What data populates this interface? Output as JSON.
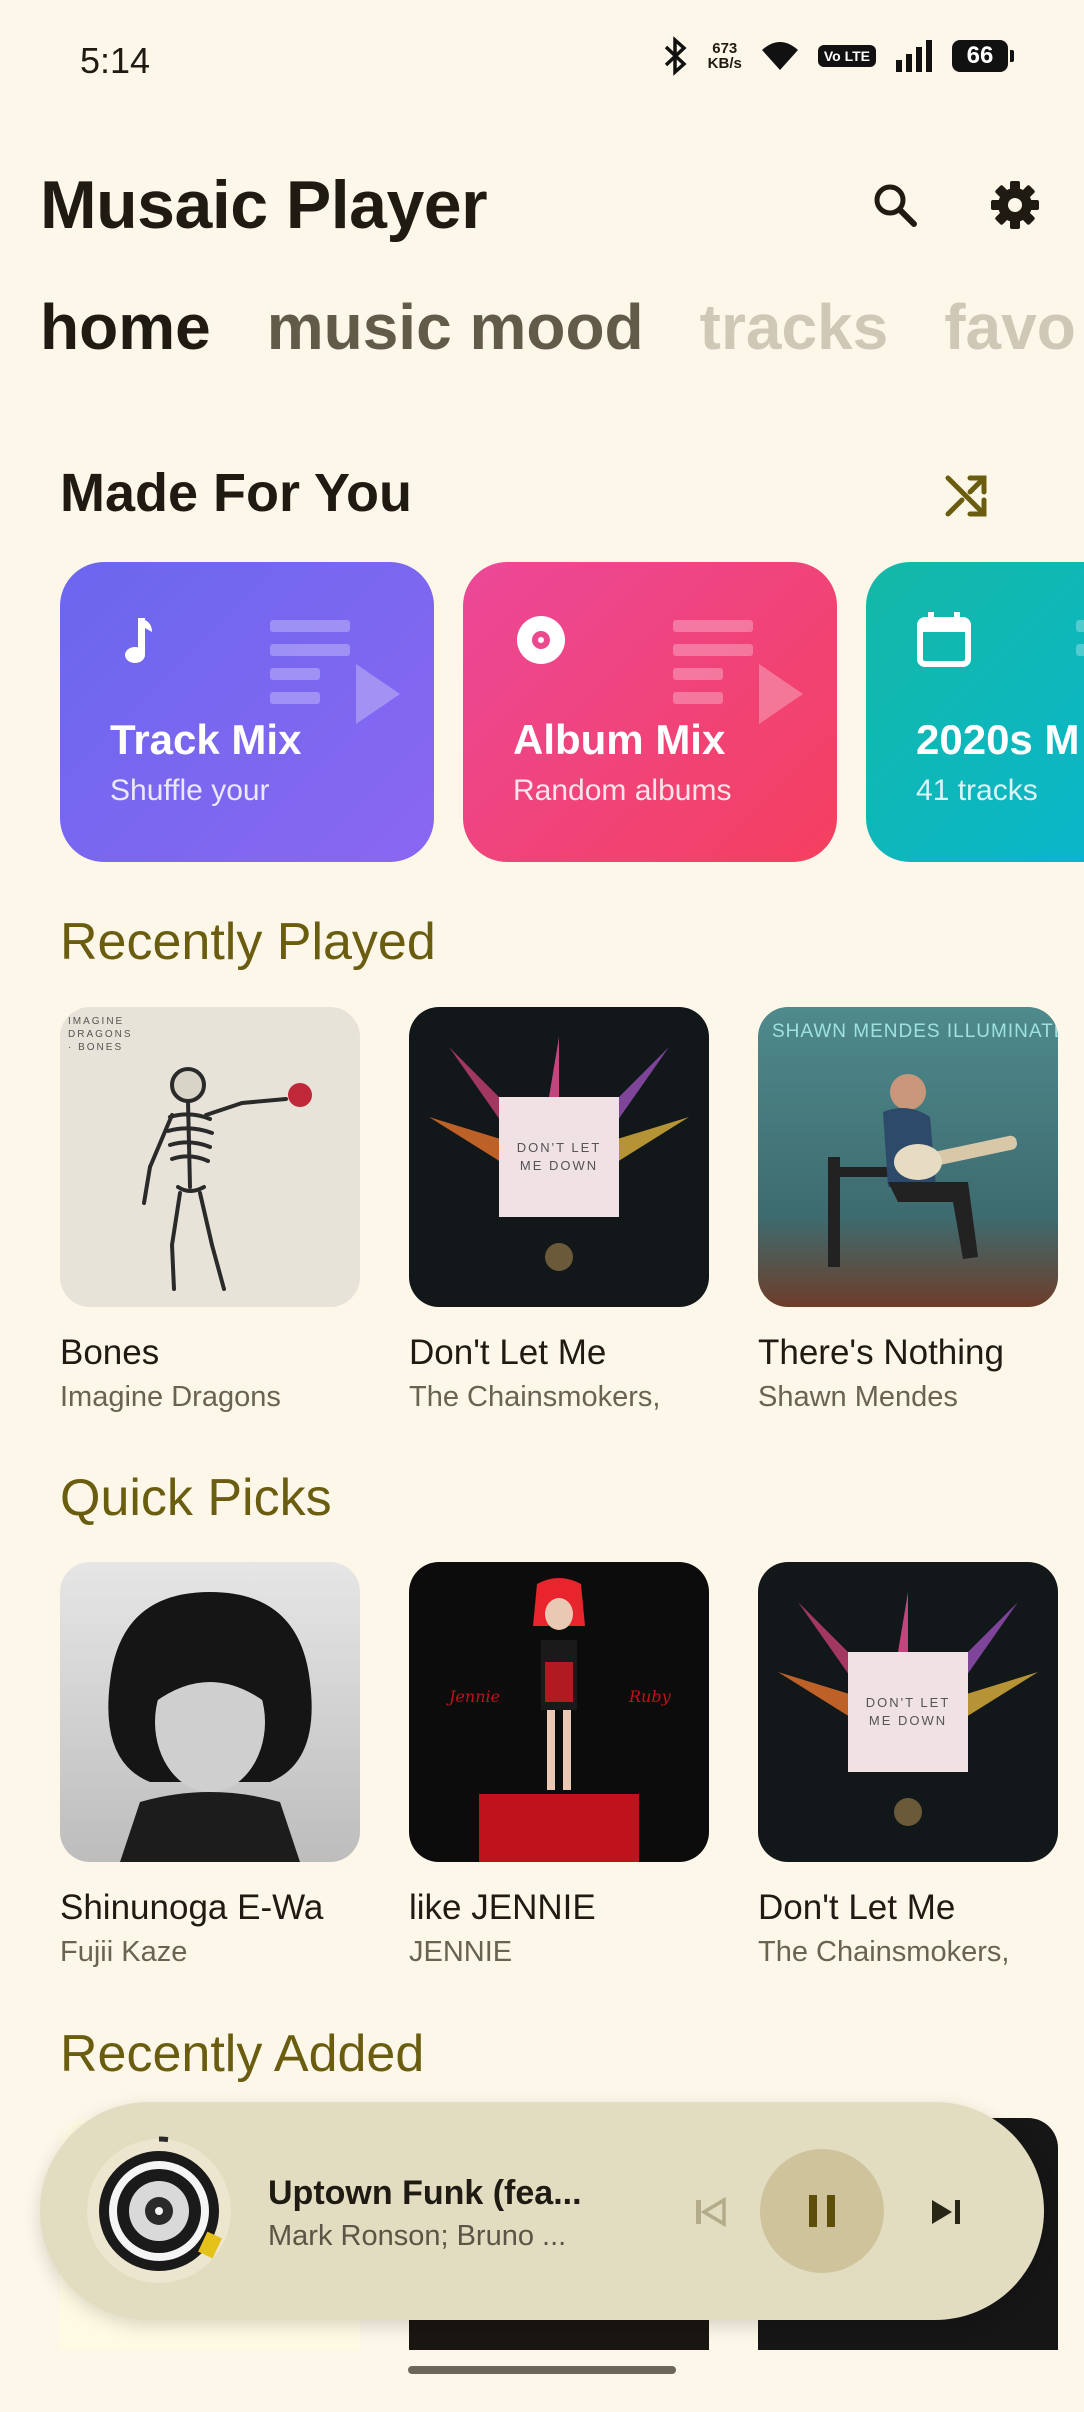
{
  "status_bar": {
    "time": "5:14",
    "net_speed_value": "673",
    "net_speed_unit": "KB/s",
    "volte": "Vo LTE",
    "battery": "66"
  },
  "header": {
    "title": "Musaic Player",
    "search_icon": "search-icon",
    "settings_icon": "gear-icon"
  },
  "tabs": [
    "home",
    "music mood",
    "tracks",
    "favo"
  ],
  "made_for_you": {
    "title": "Made For You",
    "shuffle_icon": "shuffle-icon",
    "cards": [
      {
        "title": "Track Mix",
        "subtitle": "Shuffle your",
        "icon": "music-note-icon",
        "colors": [
          "#6a67ee",
          "#8b67f2"
        ]
      },
      {
        "title": "Album Mix",
        "subtitle": "Random albums",
        "icon": "album-disc-icon",
        "colors": [
          "#ec4899",
          "#f43f5e"
        ]
      },
      {
        "title": "2020s M",
        "subtitle": "41 tracks",
        "icon": "calendar-icon",
        "colors": [
          "#14b8a6",
          "#06b6d4"
        ]
      }
    ]
  },
  "recently_played": {
    "title": "Recently Played",
    "items": [
      {
        "title": "Bones",
        "artist": "Imagine Dragons",
        "cover_text": "IMAGINE DRAGONS · BONES"
      },
      {
        "title": "Don't Let Me",
        "artist": "The Chainsmokers,",
        "cover_text": "DON'T LET ME DOWN"
      },
      {
        "title": "There's Nothing",
        "artist": "Shawn Mendes",
        "cover_text": "SHAWN MENDES ILLUMINATE"
      }
    ]
  },
  "quick_picks": {
    "title": "Quick Picks",
    "items": [
      {
        "title": "Shinunoga E-Wa",
        "artist": "Fujii Kaze"
      },
      {
        "title": "like JENNIE",
        "artist": "JENNIE"
      },
      {
        "title": "Don't Let Me",
        "artist": "The Chainsmokers,",
        "cover_text": "DON'T LET ME DOWN"
      }
    ]
  },
  "recently_added": {
    "title": "Recently Added"
  },
  "mini_player": {
    "title": "Uptown Funk (fea...",
    "artist": "Mark Ronson; Bruno ...",
    "prev_icon": "skip-previous-icon",
    "pause_icon": "pause-icon",
    "next_icon": "skip-next-icon"
  },
  "colors": {
    "background": "#fdf7e9",
    "accent_olive": "#6a5d10",
    "player_bg": "#e2dcc0"
  }
}
